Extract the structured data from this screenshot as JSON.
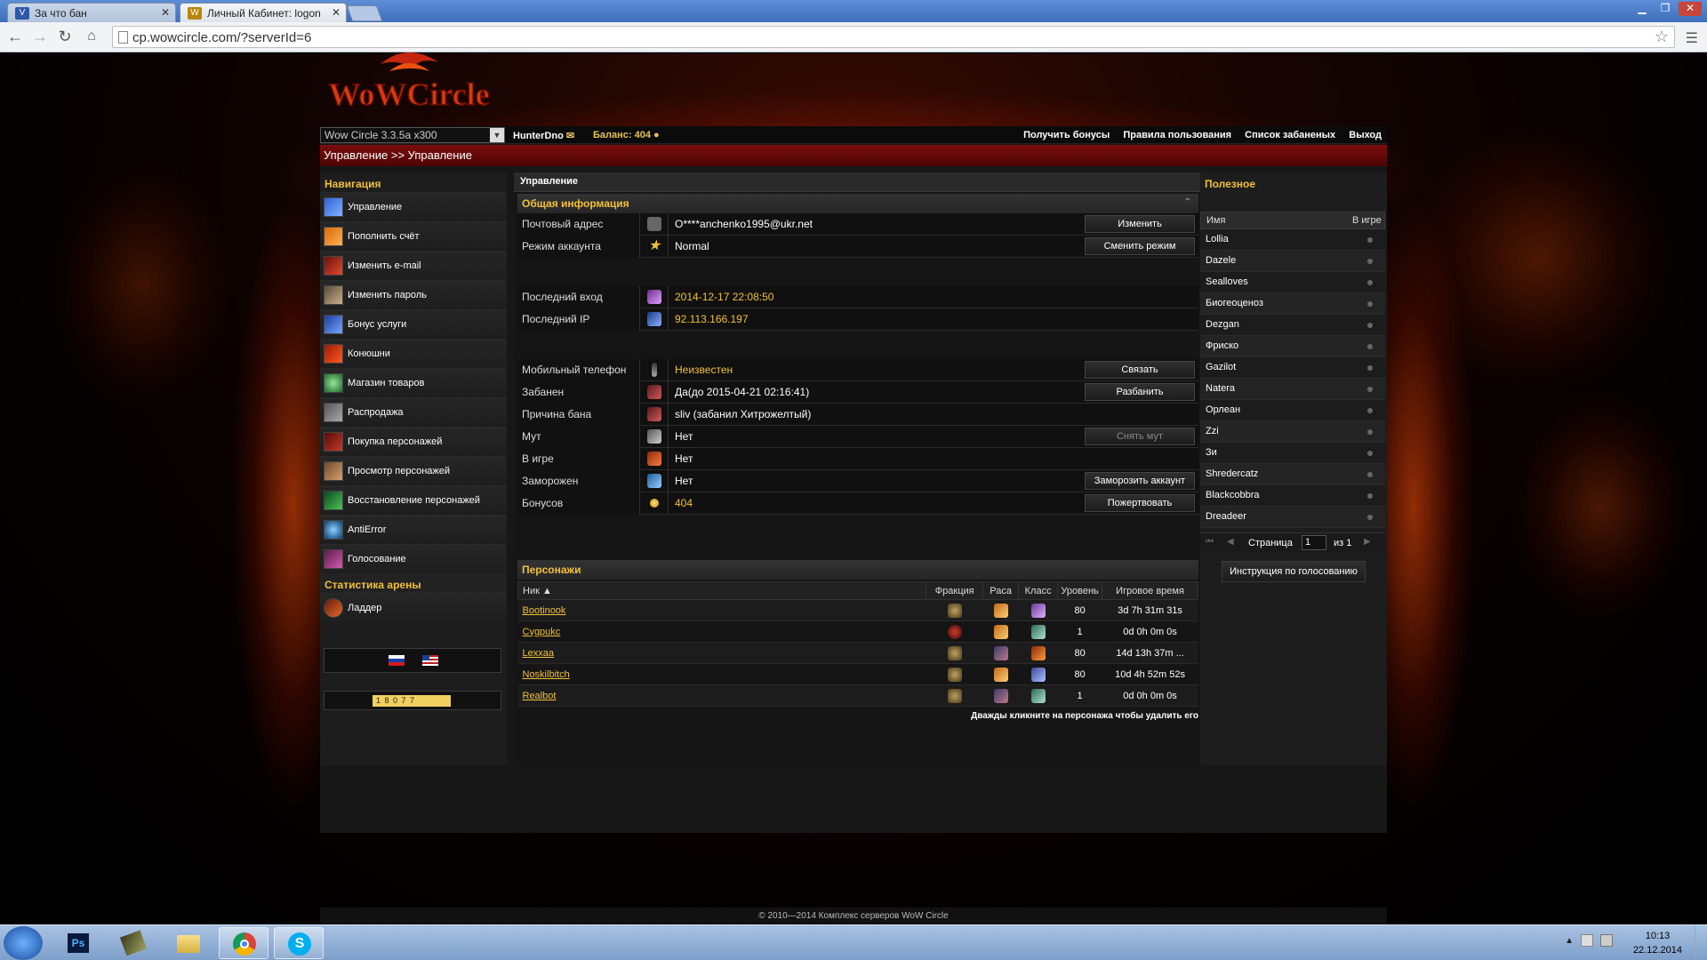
{
  "browser": {
    "tabs": [
      {
        "label": "За что бан"
      },
      {
        "label": "Личный Кабинет: logon"
      }
    ],
    "url": "cp.wowcircle.com/?serverId=6"
  },
  "site": {
    "logo_text": "WoWCircle",
    "server": "Wow Circle 3.3.5a x300",
    "username": "HunterDno",
    "balance_label": "Баланс:",
    "balance_value": "404",
    "top_links": [
      "Получить бонусы",
      "Правила пользования",
      "Список забаненых",
      "Выход"
    ],
    "breadcrumb": "Управление >> Управление"
  },
  "left": {
    "nav_title": "Навигация",
    "items": [
      "Управление",
      "Пополнить счёт",
      "Изменить e-mail",
      "Изменить пароль",
      "Бонус услуги",
      "Конюшни",
      "Магазин товаров",
      "Распродажа",
      "Покупка персонажей",
      "Просмотр персонажей",
      "Восстановление персонажей",
      "AntiError",
      "Голосование"
    ],
    "arena_title": "Статистика арены",
    "arena_item": "Ладдер",
    "counter": "1 8 0 7 7"
  },
  "main": {
    "panel_title": "Управление",
    "general_title": "Общая информация",
    "rows": [
      {
        "label": "Почтовый адрес",
        "value": "O****anchenko1995@ukr.net",
        "button": "Изменить"
      },
      {
        "label": "Режим аккаунта",
        "value": "Normal",
        "button": "Сменить режим"
      },
      {
        "label": "Последний вход",
        "value": "2014-12-17 22:08:50"
      },
      {
        "label": "Последний IP",
        "value": "92.113.166.197"
      },
      {
        "label": "Мобильный телефон",
        "value": "Неизвестен",
        "button": "Связать"
      },
      {
        "label": "Забанен",
        "value": "Да(до 2015-04-21 02:16:41)",
        "button": "Разбанить"
      },
      {
        "label": "Причина бана",
        "value": "sliv (забанил Хитрожелтый)"
      },
      {
        "label": "Мут",
        "value": "Нет",
        "button": "Снять мут"
      },
      {
        "label": "В игре",
        "value": "Нет"
      },
      {
        "label": "Заморожен",
        "value": "Нет",
        "button": "Заморозить аккаунт"
      },
      {
        "label": "Бонусов",
        "value": "404",
        "button": "Пожертвовать"
      }
    ],
    "chars_title": "Персонажи",
    "chars_headers": [
      "Ник ▲",
      "Фракция",
      "Раса",
      "Класс",
      "Уровень",
      "Игровое время"
    ],
    "chars": [
      {
        "nick": "Bootinook",
        "level": "80",
        "time": "3d 7h 31m 31s"
      },
      {
        "nick": "Cygpukc",
        "level": "1",
        "time": "0d 0h 0m 0s"
      },
      {
        "nick": "Lexxaa",
        "level": "80",
        "time": "14d 13h 37m ..."
      },
      {
        "nick": "Noskilbitch",
        "level": "80",
        "time": "10d 4h 52m 52s"
      },
      {
        "nick": "Realbot",
        "level": "1",
        "time": "0d 0h 0m 0s"
      }
    ],
    "hint": "Дважды кликните на персонажа чтобы удалить его"
  },
  "right": {
    "title": "Полезное",
    "col_name": "Имя",
    "col_ingame": "В игре",
    "players": [
      "Lollia",
      "Dazele",
      "Sealloves",
      "Биогеоценоз",
      "Dezgan",
      "Фриско",
      "Gazilot",
      "Natera",
      "Орлеан",
      "Zzi",
      "Зи",
      "Shredercatz",
      "Blackcobbra",
      "Dreadeer"
    ],
    "page_label": "Страница",
    "page_value": "1",
    "of_label": "из 1",
    "vote_button": "Инструкция по голосованию"
  },
  "footer": "© 2010—2014 Комплекс серверов WoW Circle",
  "clock": {
    "time": "10:13",
    "date": "22.12.2014"
  }
}
